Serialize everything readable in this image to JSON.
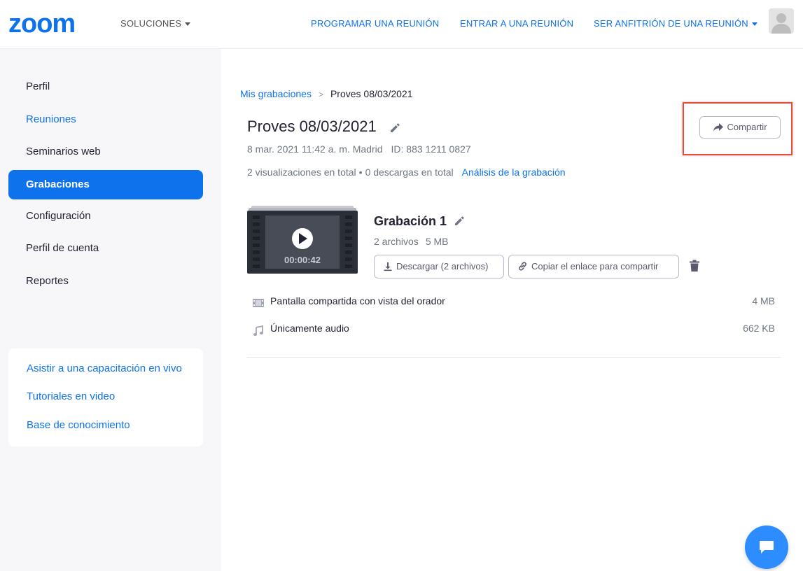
{
  "header": {
    "logo_text": "zoom",
    "solutions_label": "SOLUCIONES",
    "schedule_label": "PROGRAMAR UNA REUNIÓN",
    "join_label": "ENTRAR A UNA REUNIÓN",
    "host_label": "SER ANFITRIÓN DE UNA REUNIÓN"
  },
  "sidebar": {
    "items": [
      {
        "label": "Perfil"
      },
      {
        "label": "Reuniones"
      },
      {
        "label": "Seminarios web"
      },
      {
        "label": "Grabaciones"
      },
      {
        "label": "Configuración"
      },
      {
        "label": "Perfil de cuenta"
      },
      {
        "label": "Reportes"
      }
    ],
    "active_index": 3,
    "help_links": [
      {
        "label": "Asistir a una capacitación en vivo"
      },
      {
        "label": "Tutoriales en video"
      },
      {
        "label": "Base de conocimiento"
      }
    ]
  },
  "main": {
    "breadcrumb": {
      "parent": "Mis grabaciones",
      "separator": ">",
      "current": "Proves 08/03/2021"
    },
    "title": "Proves 08/03/2021",
    "datetime": "8 mar. 2021 11:42 a. m. Madrid",
    "meeting_id": "ID: 883 1211 0827",
    "views": "2 visualizaciones en total",
    "dot": "•",
    "downloads": "0 descargas en total",
    "analysis_link": "Análisis de la grabación",
    "share_label": "Compartir",
    "recording": {
      "title": "Grabación 1",
      "file_count": "2 archivos",
      "size": "5 MB",
      "duration": "00:00:42",
      "download_label": "Descargar (2 archivos)",
      "copy_link_label": "Copiar el enlace para compartir"
    },
    "files": [
      {
        "name": "Pantalla compartida con vista del orador",
        "size": "4 MB",
        "icon": "video-file-icon"
      },
      {
        "name": "Únicamente audio",
        "size": "662 KB",
        "icon": "audio-file-icon"
      }
    ]
  },
  "colors": {
    "accent": "#0e72ed",
    "highlight": "#e74c3c",
    "sidebar_bg": "#f7f7fa"
  }
}
